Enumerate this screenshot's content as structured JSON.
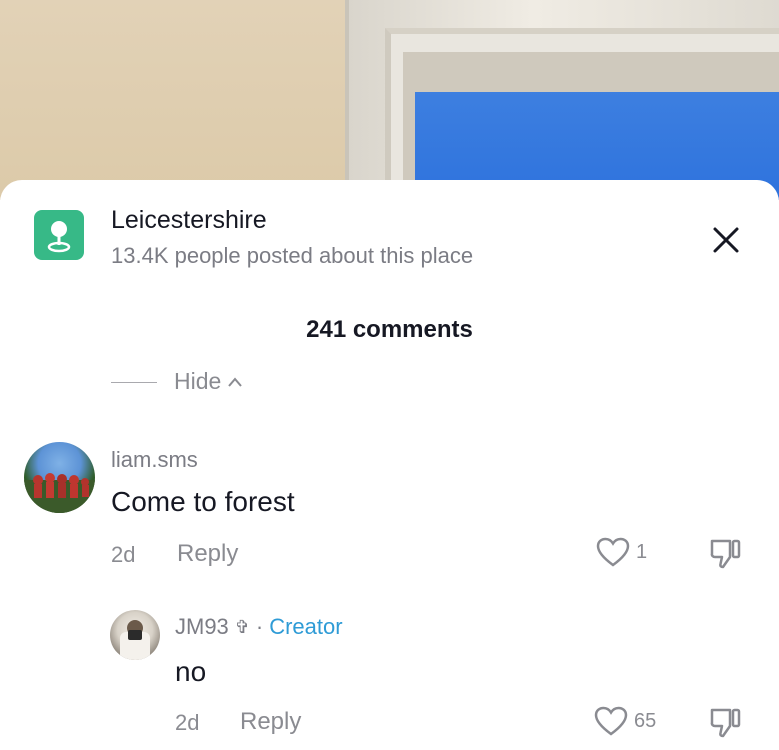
{
  "place": {
    "name": "Leicestershire",
    "subtitle": "13.4K people posted about this place",
    "icon": "location-pin-icon"
  },
  "comments_header": "241 comments",
  "hide_label": "Hide",
  "comments": [
    {
      "username": "liam.sms",
      "text": "Come to forest",
      "age": "2d",
      "reply_label": "Reply",
      "likes": "1"
    },
    {
      "username": "JM93",
      "badge_glyph": "✞",
      "separator": "·",
      "role": "Creator",
      "text": "no",
      "age": "2d",
      "reply_label": "Reply",
      "likes": "65"
    }
  ],
  "colors": {
    "place_icon": "#37b987",
    "creator": "#2e9bd6",
    "muted": "#8a8b91",
    "text": "#161823"
  }
}
